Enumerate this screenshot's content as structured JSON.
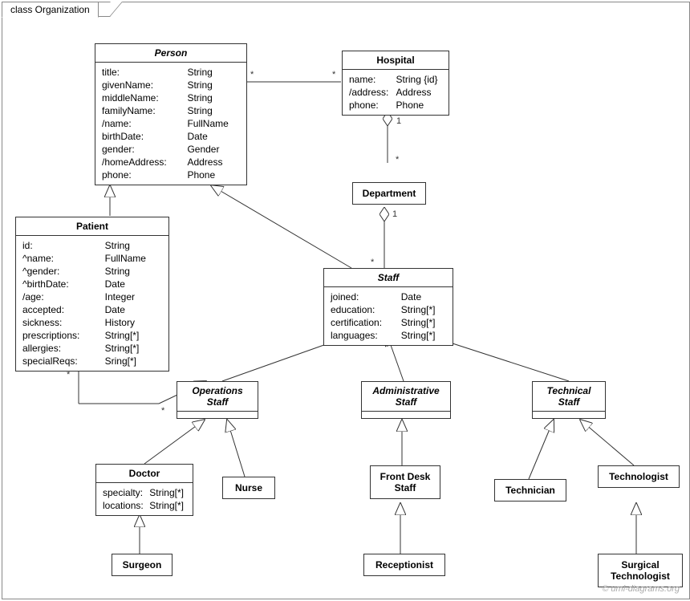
{
  "frame": {
    "title": "class Organization"
  },
  "classes": {
    "person": {
      "title": "Person",
      "attrs": [
        [
          "title:",
          "String"
        ],
        [
          "givenName:",
          "String"
        ],
        [
          "middleName:",
          "String"
        ],
        [
          "familyName:",
          "String"
        ],
        [
          "/name:",
          "FullName"
        ],
        [
          "birthDate:",
          "Date"
        ],
        [
          "gender:",
          "Gender"
        ],
        [
          "/homeAddress:",
          "Address"
        ],
        [
          "phone:",
          "Phone"
        ]
      ]
    },
    "hospital": {
      "title": "Hospital",
      "attrs": [
        [
          "name:",
          "String {id}"
        ],
        [
          "/address:",
          "Address"
        ],
        [
          "phone:",
          "Phone"
        ]
      ]
    },
    "department": {
      "title": "Department"
    },
    "patient": {
      "title": "Patient",
      "attrs": [
        [
          "id:",
          "String"
        ],
        [
          "^name:",
          "FullName"
        ],
        [
          "^gender:",
          "String"
        ],
        [
          "^birthDate:",
          "Date"
        ],
        [
          "/age:",
          "Integer"
        ],
        [
          "accepted:",
          "Date"
        ],
        [
          "sickness:",
          "History"
        ],
        [
          "prescriptions:",
          "String[*]"
        ],
        [
          "allergies:",
          "String[*]"
        ],
        [
          "specialReqs:",
          "Sring[*]"
        ]
      ]
    },
    "staff": {
      "title": "Staff",
      "attrs": [
        [
          "joined:",
          "Date"
        ],
        [
          "education:",
          "String[*]"
        ],
        [
          "certification:",
          "String[*]"
        ],
        [
          "languages:",
          "String[*]"
        ]
      ]
    },
    "opsStaff": {
      "title": "Operations Staff"
    },
    "adminStaff": {
      "title": "Administrative Staff"
    },
    "techStaff": {
      "title": "Technical Staff"
    },
    "doctor": {
      "title": "Doctor",
      "attrs": [
        [
          "specialty:",
          "String[*]"
        ],
        [
          "locations:",
          "String[*]"
        ]
      ]
    },
    "nurse": {
      "title": "Nurse"
    },
    "frontDesk": {
      "title": "Front Desk Staff"
    },
    "technician": {
      "title": "Technician"
    },
    "technologist": {
      "title": "Technologist"
    },
    "surgeon": {
      "title": "Surgeon"
    },
    "receptionist": {
      "title": "Receptionist"
    },
    "surgTech": {
      "title": "Surgical Technologist"
    }
  },
  "mult": {
    "star": "*",
    "one": "1"
  },
  "watermark": "© uml-diagrams.org"
}
